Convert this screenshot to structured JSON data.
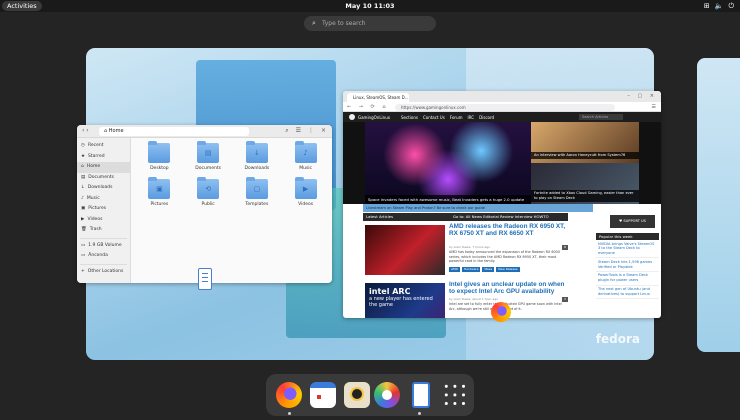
{
  "topbar": {
    "activities": "Activities",
    "clock": "May 10  11:03",
    "tray": {
      "network_icon": "network-icon",
      "volume_icon": "volume-icon",
      "power_icon": "power-icon"
    }
  },
  "search": {
    "placeholder": "Type to search"
  },
  "files_window": {
    "path": "Home",
    "sidebar": {
      "items": [
        {
          "label": "Recent",
          "icon": "clock-icon"
        },
        {
          "label": "Starred",
          "icon": "star-icon"
        },
        {
          "label": "Home",
          "icon": "home-icon"
        },
        {
          "label": "Documents",
          "icon": "document-icon"
        },
        {
          "label": "Downloads",
          "icon": "download-icon"
        },
        {
          "label": "Music",
          "icon": "music-icon"
        },
        {
          "label": "Pictures",
          "icon": "picture-icon"
        },
        {
          "label": "Videos",
          "icon": "video-icon"
        },
        {
          "label": "Trash",
          "icon": "trash-icon"
        },
        {
          "label": "1.9 GB Volume",
          "icon": "drive-icon"
        },
        {
          "label": "Ānconda",
          "icon": "drive-icon"
        },
        {
          "label": "Other Locations",
          "icon": "plus-icon"
        }
      ]
    },
    "folders": [
      {
        "label": "Desktop"
      },
      {
        "label": "Documents"
      },
      {
        "label": "Downloads"
      },
      {
        "label": "Music"
      },
      {
        "label": "Pictures"
      },
      {
        "label": "Public"
      },
      {
        "label": "Templates"
      },
      {
        "label": "Videos"
      }
    ]
  },
  "browser_window": {
    "tab_title": "Linux, SteamOS, Steam D...",
    "url": "https://www.gamingonlinux.com",
    "site": {
      "name": "GamingOnLinux",
      "menu": [
        "Sections",
        "Contact Us",
        "Forum",
        "IRC",
        "Discord"
      ],
      "search_placeholder": "Search Articles",
      "hero_caption": "Space Invaders faced with awesome music, Beat Invaders gets a huge 2.0 update",
      "hero_right_1": "An interview with Aaron Honeycutt from System76",
      "hero_right_2": "Fortnite added to Xbox Cloud Gaming, easier than ever to play on Steam Deck",
      "banner": "Livestream on Steam Play and Proton? Be sure to check our guide",
      "latest_label": "Latest Articles",
      "goto_label": "Go to: All News  Editorial  Review  Interview  HOWTO",
      "support": "♥ SUPPORT US",
      "articles": [
        {
          "title": "AMD releases the Radeon RX 6950 XT, RX 6750 XT and RX 6650 XT",
          "byline": "by Liam Dawe, 7 hours ago",
          "excerpt": "AMD has today announced the expansion of the Radeon RX 6000 series, which includes the AMD Radeon RX 6950 XT, their most powerful card in the family.",
          "comments": "8",
          "tags": [
            "AMD",
            "Hardware",
            "Mesa",
            "New Release"
          ]
        },
        {
          "title": "Intel gives an unclear update on when to expect Intel Arc GPU availability",
          "byline": "by Liam Dawe, about 1 hour ago",
          "excerpt": "Intel are set to fully enter the dedicated GPU game soon with Intel Arc, although we're still awaiting a lot of it.",
          "comments": "3",
          "image_text_1": "intel ARC",
          "image_text_2": "a new player has entered the game"
        }
      ],
      "popular_title": "Popular this week",
      "popular": [
        "NVIDIA brings Valve's SteamOS 3 to the Steam Deck to everyone",
        "Steam Deck hits 1,596 games Verified or Playable",
        "PowerTools is a Steam Deck plugin for power users",
        "The next gen of Ubuntu (and derivatives) to support Linux"
      ]
    }
  },
  "wallpaper": {
    "brand": "fedora"
  },
  "dock": {
    "apps": [
      {
        "name": "firefox-icon"
      },
      {
        "name": "calendar-icon"
      },
      {
        "name": "rhythmbox-icon"
      },
      {
        "name": "software-icon"
      },
      {
        "name": "files-icon"
      },
      {
        "name": "app-grid-icon"
      }
    ]
  }
}
